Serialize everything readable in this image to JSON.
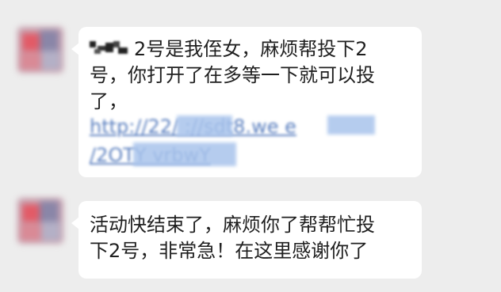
{
  "conversation": {
    "messages": [
      {
        "id": "msg-1",
        "has_redacted_mention": true,
        "lines": [
          "2号是我侄女，麻烦帮投下2",
          "号，你打开了在多等一下就可以投",
          "了，"
        ],
        "link_lines": [
          "http://22/   ://sdt8.we     e",
          "/2OTY       vrbwY"
        ]
      },
      {
        "id": "msg-2",
        "has_redacted_mention": false,
        "lines": [
          "活动快结束了，麻烦你了帮帮忙投",
          "下2号，非常急！在这里感谢你了"
        ],
        "link_lines": []
      }
    ]
  },
  "colors": {
    "background": "#ededed",
    "bubble": "#ffffff",
    "text": "#1f1f1f",
    "link": "#5a7fbf"
  }
}
